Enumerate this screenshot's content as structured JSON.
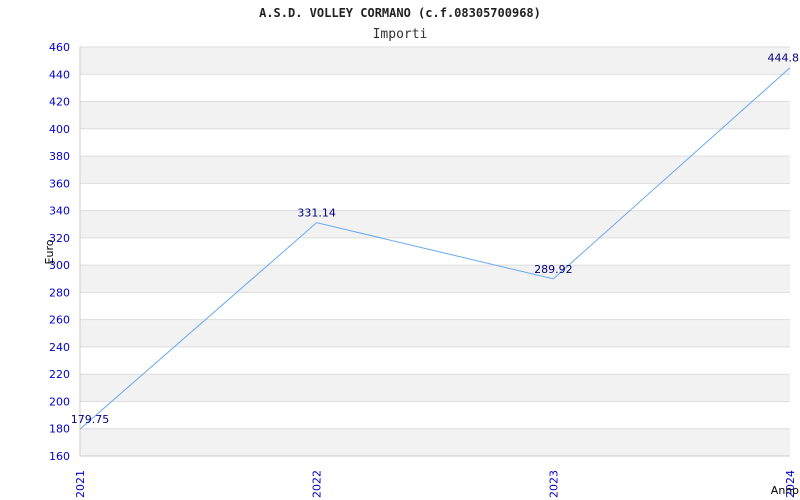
{
  "header": {
    "title": "A.S.D. VOLLEY CORMANO (c.f.08305700968)",
    "subtitle": "Importi"
  },
  "chart_data": {
    "type": "line",
    "x": [
      "2021",
      "2022",
      "2023",
      "2024"
    ],
    "series": [
      {
        "values": [
          179.75,
          331.14,
          289.92,
          444.8
        ],
        "labels": [
          "179.75",
          "331.14",
          "289.92",
          "444.8"
        ]
      }
    ],
    "xlabel": "Anno",
    "ylabel": "Euro",
    "ylim": [
      160,
      460
    ],
    "yticks": [
      "160",
      "180",
      "200",
      "220",
      "240",
      "260",
      "280",
      "300",
      "320",
      "340",
      "360",
      "380",
      "400",
      "420",
      "440",
      "460"
    ],
    "grid": "horizontal alternating bands",
    "line_color": "#6aa8ee",
    "tick_color": "#0000cc",
    "band_color": "#f2f2f2"
  }
}
